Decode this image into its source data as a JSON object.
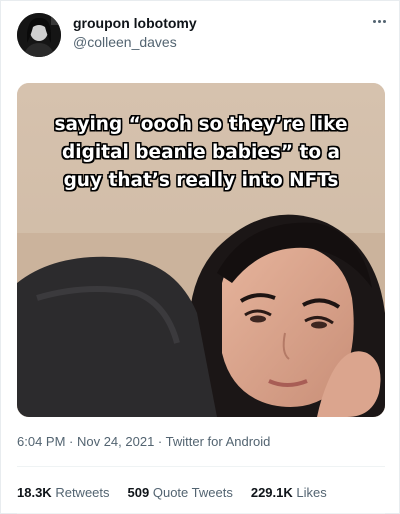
{
  "tweet": {
    "display_name": "groupon lobotomy",
    "handle": "@colleen_daves",
    "more_icon": "more-dots-icon",
    "media": {
      "caption_lines": [
        "saying “oooh so they’re like",
        "digital beanie babies” to a",
        "guy that’s really into NFTs"
      ]
    },
    "meta": "6:04 PM · Nov 24, 2021 · Twitter for Android",
    "stats": [
      {
        "value": "18.3K",
        "label": "Retweets"
      },
      {
        "value": "509",
        "label": "Quote Tweets"
      },
      {
        "value": "229.1K",
        "label": "Likes"
      }
    ]
  },
  "colors": {
    "text_primary": "#0f1419",
    "text_secondary": "#536471",
    "divider": "#eff3f4"
  }
}
